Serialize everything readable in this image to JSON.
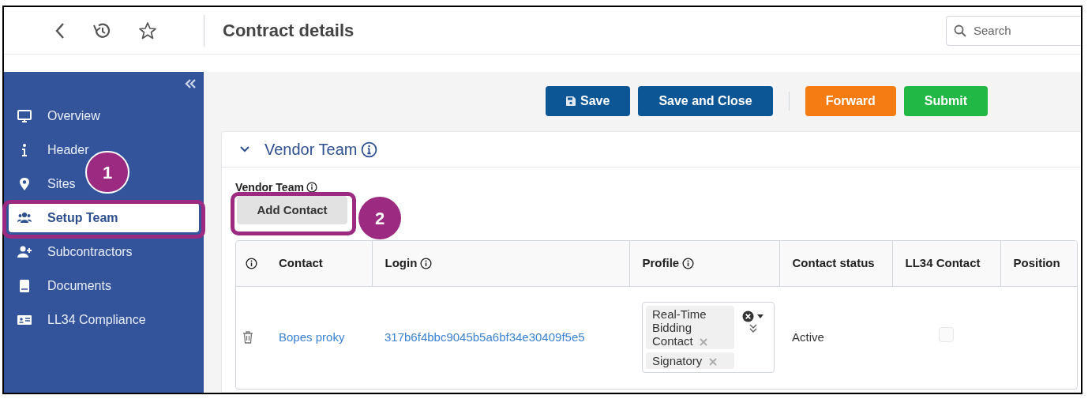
{
  "header": {
    "title": "Contract details",
    "search": {
      "placeholder": "Search"
    }
  },
  "sidebar": {
    "items": [
      {
        "label": "Overview",
        "selected": false
      },
      {
        "label": "Header",
        "selected": false
      },
      {
        "label": "Sites",
        "selected": false
      },
      {
        "label": "Setup Team",
        "selected": true
      },
      {
        "label": "Subcontractors",
        "selected": false
      },
      {
        "label": "Documents",
        "selected": false
      },
      {
        "label": "LL34 Compliance",
        "selected": false
      }
    ]
  },
  "toolbar": [
    {
      "label": "Save",
      "kind": "primary"
    },
    {
      "label": "Save and Close",
      "kind": "primary"
    },
    {
      "kind": "separator"
    },
    {
      "label": "Forward",
      "kind": "warning"
    },
    {
      "label": "Submit",
      "kind": "success"
    }
  ],
  "section": {
    "title": "Vendor Team",
    "expanded": true,
    "field_label": "Vendor Team",
    "add_button": "Add Contact",
    "table": {
      "columns": [
        {
          "info": true
        },
        {
          "label": "Contact",
          "info": false
        },
        {
          "label": "Login",
          "info": true
        },
        {
          "label": "Profile",
          "info": true
        },
        {
          "label": "Contact status",
          "info": false
        },
        {
          "label": "LL34 Contact",
          "info": false
        },
        {
          "label": "Position",
          "info": false
        }
      ],
      "rows": [
        {
          "contact": "Bopes proky",
          "login": "317b6f4bbc9045b5a6bf34e30409f5e5",
          "profiles": [
            "Real-Time Bidding Contact",
            "Signatory"
          ],
          "status": "Active",
          "ll34_contact": {
            "checked": false
          }
        }
      ]
    }
  },
  "annotations": [
    {
      "number": "1"
    },
    {
      "number": "2"
    }
  ]
}
